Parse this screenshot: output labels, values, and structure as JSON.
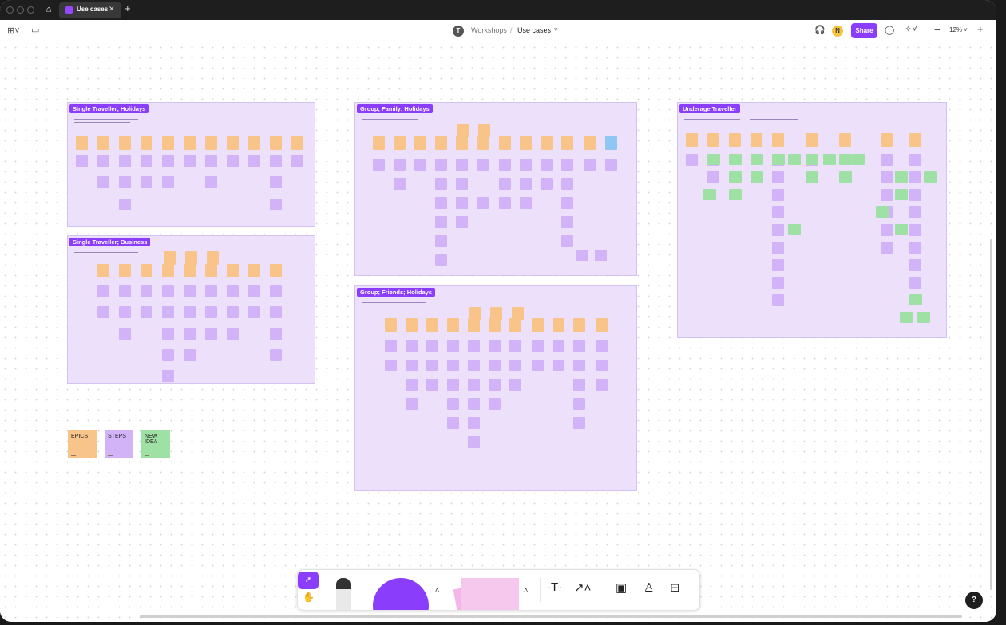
{
  "tabs": {
    "active_label": "Use cases"
  },
  "breadcrumb": {
    "avatar_initial": "T",
    "parent": "Workshops",
    "separator": "/",
    "current": "Use cases"
  },
  "header": {
    "user_initial": "N",
    "share_label": "Share",
    "zoom": "12%"
  },
  "sections": [
    {
      "title": "Single Traveller; Holidays"
    },
    {
      "title": "Single Traveller; Business"
    },
    {
      "title": "Group; Family; Holidays"
    },
    {
      "title": "Group; Friends; Holidays"
    },
    {
      "title": "Underage Traveller"
    }
  ],
  "legend": {
    "epics": "EPICS",
    "steps": "STEPS",
    "new_idea_1": "NEW",
    "new_idea_2": "IDEA"
  },
  "colors": {
    "accent": "#8b3dfc",
    "section_bg": "#ece0fb",
    "epic": "#f9c48a",
    "step": "#d3b3f7",
    "new_idea": "#9fe0a5",
    "extra": "#8fc7f4"
  },
  "icons": {
    "select": "cursor-icon",
    "hand": "hand-icon",
    "text": "text-icon",
    "connector": "connector-icon",
    "section": "section-icon",
    "stamp": "stamp-icon",
    "more": "more-tools-icon",
    "help": "help-icon"
  },
  "help_label": "?"
}
